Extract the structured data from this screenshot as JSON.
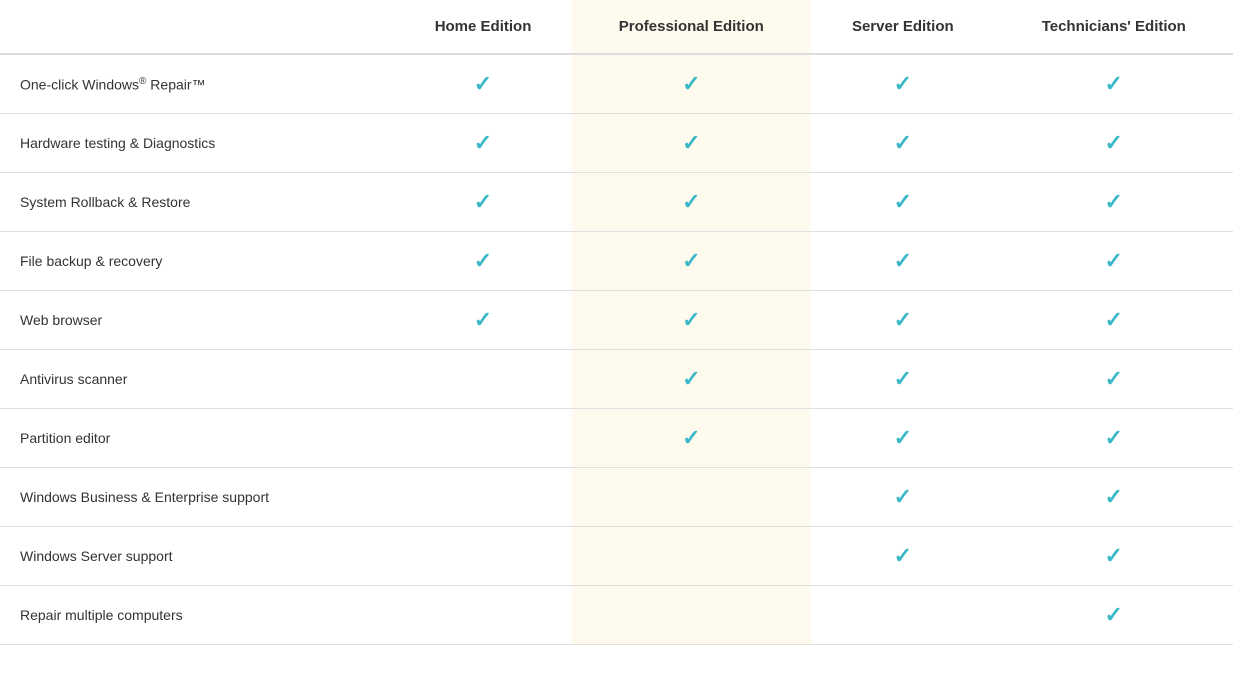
{
  "table": {
    "columns": [
      {
        "key": "feature",
        "label": "",
        "highlight": false
      },
      {
        "key": "home",
        "label": "Home Edition",
        "highlight": false
      },
      {
        "key": "professional",
        "label": "Professional Edition",
        "highlight": true
      },
      {
        "key": "server",
        "label": "Server Edition",
        "highlight": false
      },
      {
        "key": "technicians",
        "label": "Technicians' Edition",
        "highlight": false
      }
    ],
    "rows": [
      {
        "feature": "One-click Windows® Repair™",
        "feature_html": true,
        "home": true,
        "professional": true,
        "server": true,
        "technicians": true
      },
      {
        "feature": "Hardware testing & Diagnostics",
        "home": true,
        "professional": true,
        "server": true,
        "technicians": true
      },
      {
        "feature": "System Rollback & Restore",
        "home": true,
        "professional": true,
        "server": true,
        "technicians": true
      },
      {
        "feature": "File backup & recovery",
        "home": true,
        "professional": true,
        "server": true,
        "technicians": true
      },
      {
        "feature": "Web browser",
        "home": true,
        "professional": true,
        "server": true,
        "technicians": true
      },
      {
        "feature": "Antivirus scanner",
        "home": false,
        "professional": true,
        "server": true,
        "technicians": true
      },
      {
        "feature": "Partition editor",
        "home": false,
        "professional": true,
        "server": true,
        "technicians": true
      },
      {
        "feature": "Windows Business & Enterprise support",
        "home": false,
        "professional": false,
        "server": true,
        "technicians": true
      },
      {
        "feature": "Windows Server support",
        "home": false,
        "professional": false,
        "server": true,
        "technicians": true
      },
      {
        "feature": "Repair multiple computers",
        "home": false,
        "professional": false,
        "server": false,
        "technicians": true
      }
    ]
  }
}
